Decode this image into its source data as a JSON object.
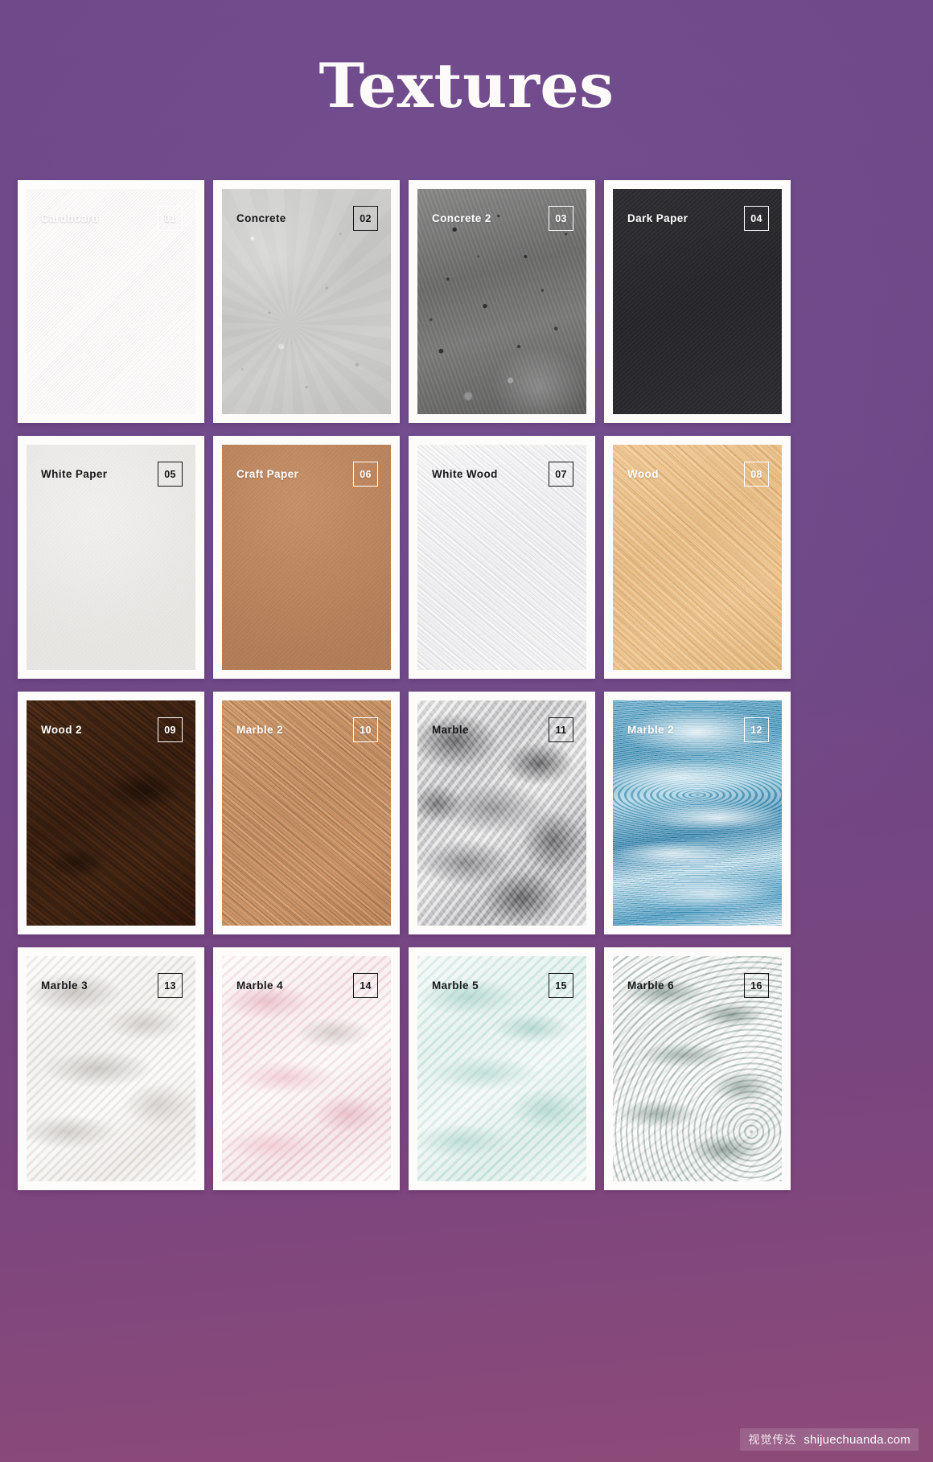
{
  "page": {
    "title": "Textures",
    "background_color": "#6b4486",
    "card_background": "#fdfcfb"
  },
  "cards": [
    {
      "label": "Cardboard",
      "number": "01",
      "text_tone": "light",
      "texture": "t-cardboard",
      "color": "#ab7a47"
    },
    {
      "label": "Concrete",
      "number": "02",
      "text_tone": "dark",
      "texture": "t-concrete",
      "color": "#c8c8c6"
    },
    {
      "label": "Concrete 2",
      "number": "03",
      "text_tone": "light",
      "texture": "t-concrete2",
      "color": "#6e6e6d"
    },
    {
      "label": "Dark Paper",
      "number": "04",
      "text_tone": "light",
      "texture": "t-darkpaper",
      "color": "#2d2d31"
    },
    {
      "label": "White Paper",
      "number": "05",
      "text_tone": "dark",
      "texture": "t-whitepaper",
      "color": "#ecebe8"
    },
    {
      "label": "Craft Paper",
      "number": "06",
      "text_tone": "light",
      "texture": "t-craftpaper",
      "color": "#bb855e"
    },
    {
      "label": "White Wood",
      "number": "07",
      "text_tone": "dark",
      "texture": "t-whitewood",
      "color": "#f2f2f3"
    },
    {
      "label": "Wood",
      "number": "08",
      "text_tone": "light",
      "texture": "t-wood",
      "color": "#e7bd86"
    },
    {
      "label": "Wood 2",
      "number": "09",
      "text_tone": "light",
      "texture": "t-wood2",
      "color": "#3b2011"
    },
    {
      "label": "Marble 2",
      "number": "10",
      "text_tone": "light",
      "texture": "t-marble2tan",
      "color": "#c48f63"
    },
    {
      "label": "Marble",
      "number": "11",
      "text_tone": "dark",
      "texture": "t-marblegrey",
      "color": "#cfcfd1"
    },
    {
      "label": "Marble 2",
      "number": "12",
      "text_tone": "light",
      "texture": "t-marbleblue",
      "color": "#3f8fb5"
    },
    {
      "label": "Marble 3",
      "number": "13",
      "text_tone": "dark",
      "texture": "t-marble3",
      "color": "#eceae7"
    },
    {
      "label": "Marble 4",
      "number": "14",
      "text_tone": "dark",
      "texture": "t-marble4",
      "color": "#f4e3e6"
    },
    {
      "label": "Marble 5",
      "number": "15",
      "text_tone": "dark",
      "texture": "t-marble5",
      "color": "#d8ebe6"
    },
    {
      "label": "Marble 6",
      "number": "16",
      "text_tone": "dark",
      "texture": "t-marble6",
      "color": "#e4e9e6"
    }
  ],
  "watermark": {
    "cn_text": "视觉传达",
    "url": "shijuechuanda.com"
  }
}
